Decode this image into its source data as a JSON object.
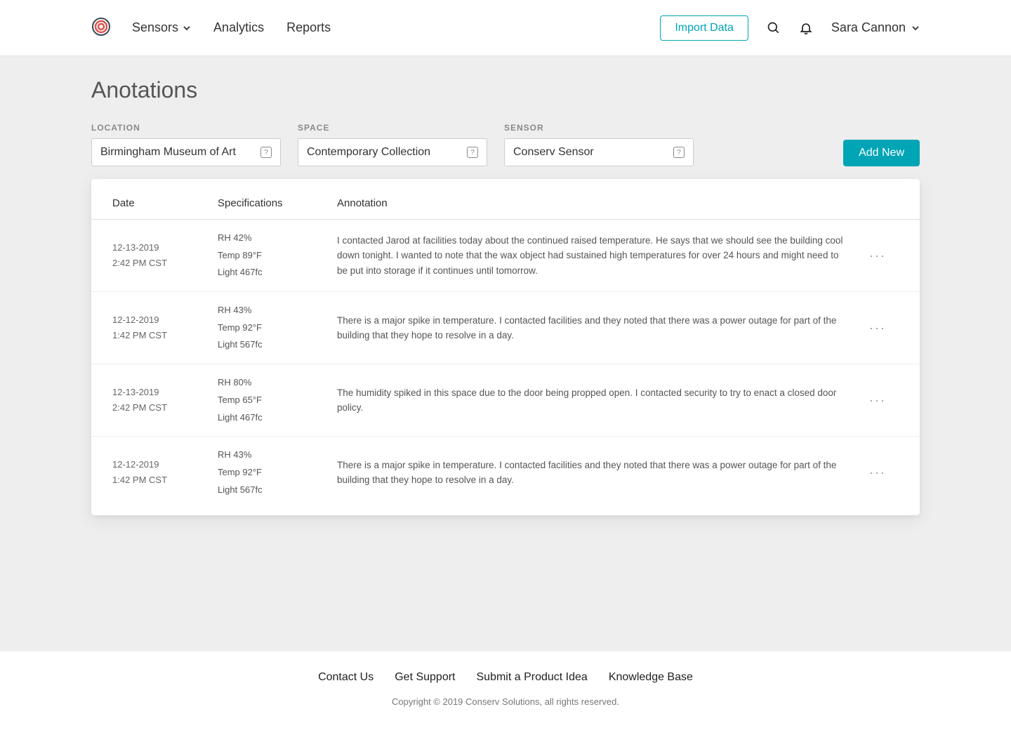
{
  "header": {
    "nav": {
      "sensors": "Sensors",
      "analytics": "Analytics",
      "reports": "Reports"
    },
    "import_button": "Import Data",
    "user_name": "Sara Cannon"
  },
  "page": {
    "title": "Anotations",
    "filters": {
      "location": {
        "label": "LOCATION",
        "value": "Birmingham Museum of Art"
      },
      "space": {
        "label": "SPACE",
        "value": "Contemporary Collection"
      },
      "sensor": {
        "label": "SENSOR",
        "value": "Conserv Sensor"
      }
    },
    "add_new_button": "Add New"
  },
  "table": {
    "headers": {
      "date": "Date",
      "specs": "Specifications",
      "annotation": "Annotation"
    },
    "rows": [
      {
        "date_line1": "12-13-2019",
        "date_line2": "2:42 PM CST",
        "spec_rh": "RH 42%",
        "spec_temp": "Temp 89°F",
        "spec_light": "Light 467fc",
        "annotation": "I contacted Jarod at facilities today about the continued raised temperature. He says that we should see the building cool down tonight. I wanted to note that the wax object had sustained high temperatures for over 24 hours and might need to be put into storage if it continues until tomorrow."
      },
      {
        "date_line1": "12-12-2019",
        "date_line2": "1:42 PM CST",
        "spec_rh": "RH 43%",
        "spec_temp": "Temp 92°F",
        "spec_light": "Light 567fc",
        "annotation": "There is a major spike in temperature. I contacted facilities and they noted that there was a power outage for part of the building that they hope to resolve in a day."
      },
      {
        "date_line1": "12-13-2019",
        "date_line2": "2:42 PM CST",
        "spec_rh": "RH 80%",
        "spec_temp": "Temp 65°F",
        "spec_light": "Light 467fc",
        "annotation": "The humidity spiked in this space due to the door being propped open. I contacted security to try to enact a closed door policy."
      },
      {
        "date_line1": "12-12-2019",
        "date_line2": "1:42 PM CST",
        "spec_rh": "RH 43%",
        "spec_temp": "Temp 92°F",
        "spec_light": "Light 567fc",
        "annotation": "There is a major spike in temperature. I contacted facilities and they noted that there was a power outage for part of the building that they hope to resolve in a day."
      }
    ]
  },
  "footer": {
    "links": {
      "contact": "Contact Us",
      "support": "Get Support",
      "idea": "Submit a Product Idea",
      "kb": "Knowledge Base"
    },
    "copyright": "Copyright © 2019 Conserv Solutions, all rights reserved."
  }
}
